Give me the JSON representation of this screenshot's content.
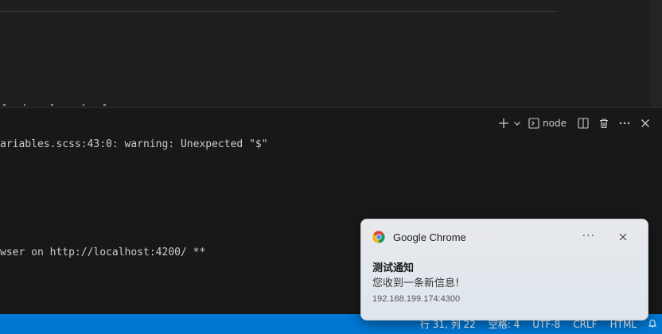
{
  "terminal": {
    "shell_label": "node",
    "lines": [
      "ariables.scss:43:0: warning: Unexpected \"$\"",
      "wser on http://localhost:4200/ **"
    ]
  },
  "statusbar": {
    "cursor": "行 31, 列 22",
    "indent": "空格: 4",
    "encoding": "UTF-8",
    "eol": "CRLF",
    "language": "HTML"
  },
  "notification": {
    "app_name": "Google Chrome",
    "title": "测试通知",
    "body": "您收到一条新信息!",
    "source": "192.168.199.174:4300"
  },
  "colors": {
    "statusbar": "#0078d4",
    "panel": "#181818",
    "editor": "#1f1f1f"
  }
}
